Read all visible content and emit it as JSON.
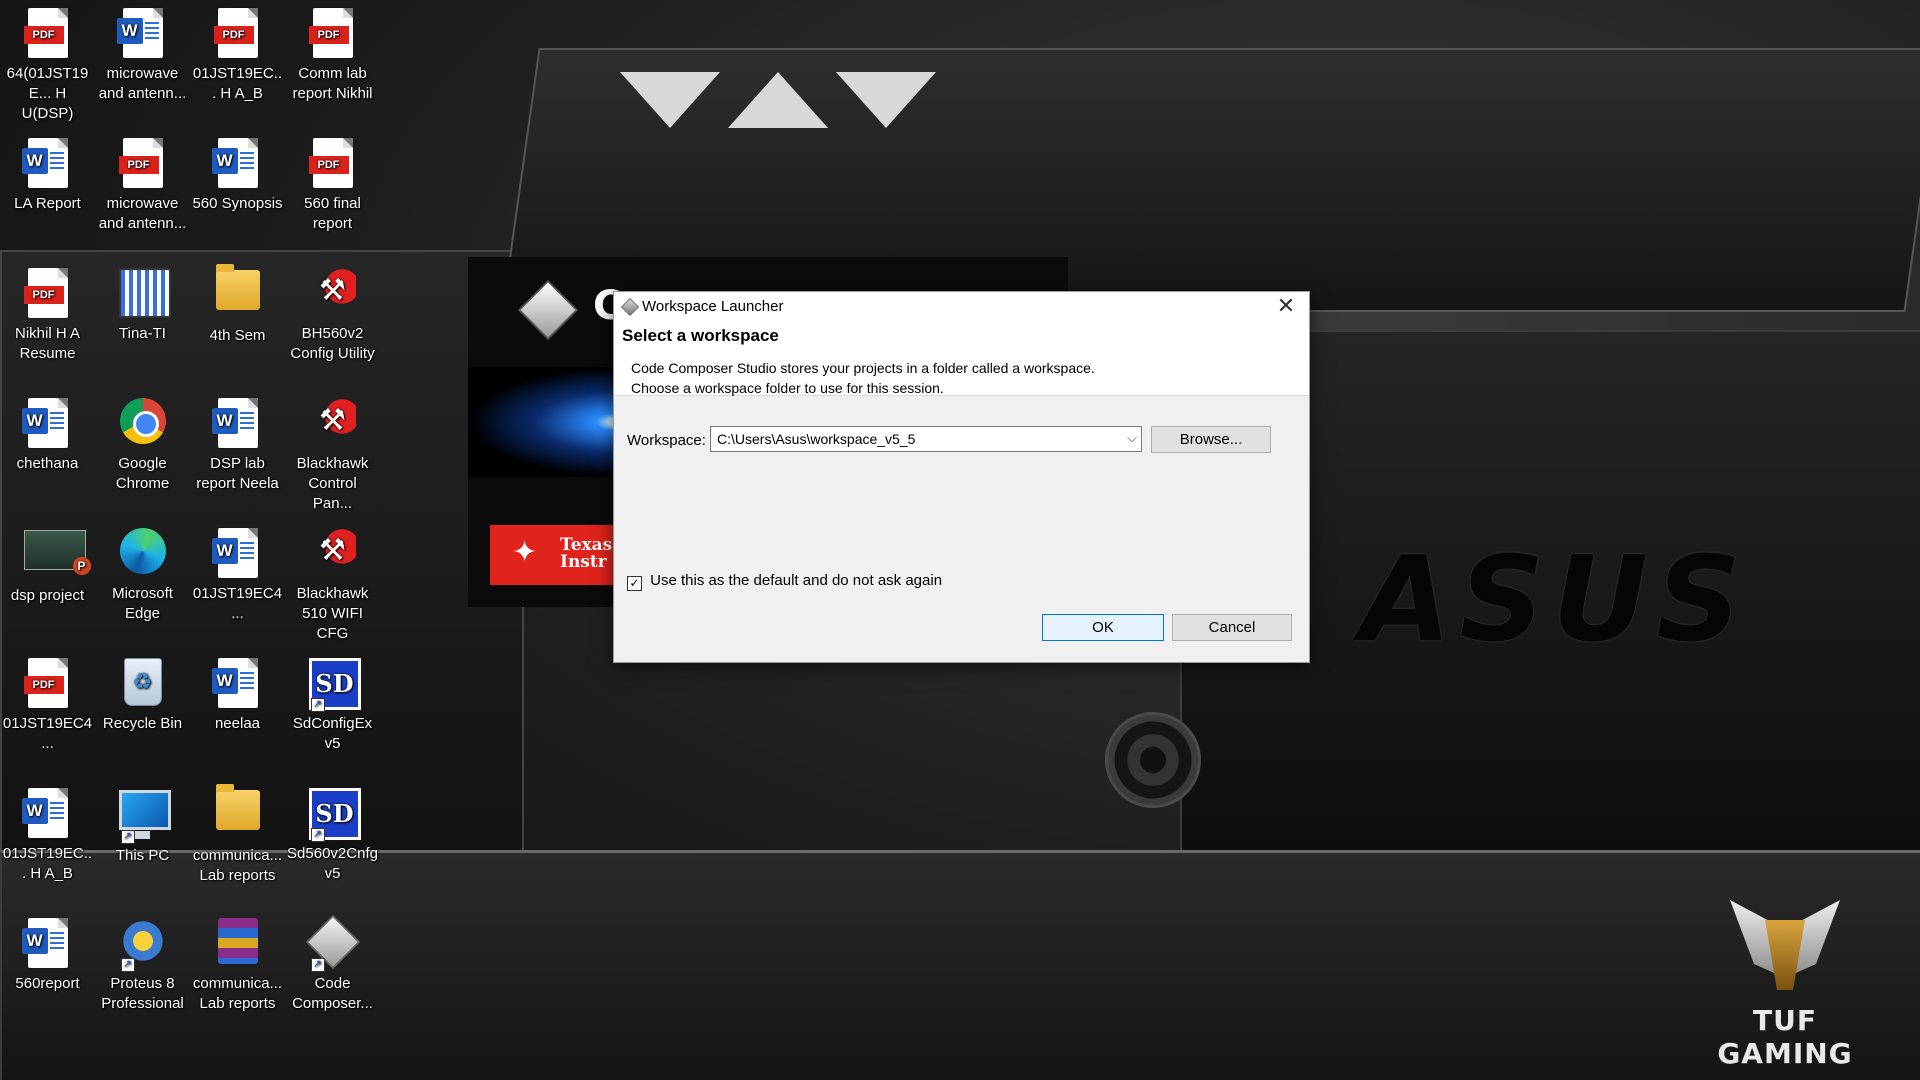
{
  "desktop": {
    "icons": [
      {
        "label": "64(01JST19E... H U(DSP)",
        "type": "pdf"
      },
      {
        "label": "microwave and antenn...",
        "type": "word"
      },
      {
        "label": "01JST19EC... H A_B",
        "type": "pdf"
      },
      {
        "label": "Comm lab report Nikhil",
        "type": "pdf"
      },
      {
        "label": "LA Report",
        "type": "word"
      },
      {
        "label": "microwave and antenn...",
        "type": "pdf"
      },
      {
        "label": "560 Synopsis",
        "type": "word"
      },
      {
        "label": "560 final report",
        "type": "pdf"
      },
      {
        "label": "Nikhil H A Resume",
        "type": "pdf"
      },
      {
        "label": "Tina-TI",
        "type": "tina"
      },
      {
        "label": "4th Sem",
        "type": "folder"
      },
      {
        "label": "BH560v2 Config Utility",
        "type": "tool"
      },
      {
        "label": "chethana",
        "type": "word"
      },
      {
        "label": "Google Chrome",
        "type": "chrome"
      },
      {
        "label": "DSP lab report Neela",
        "type": "word"
      },
      {
        "label": "Blackhawk Control Pan...",
        "type": "tool"
      },
      {
        "label": "dsp project",
        "type": "ppt"
      },
      {
        "label": "Microsoft Edge",
        "type": "edge"
      },
      {
        "label": "01JST19EC4...",
        "type": "word"
      },
      {
        "label": "Blackhawk 510 WIFI CFG",
        "type": "tool"
      },
      {
        "label": "01JST19EC4...",
        "type": "pdf"
      },
      {
        "label": "Recycle Bin",
        "type": "bin"
      },
      {
        "label": "neelaa",
        "type": "word"
      },
      {
        "label": "SdConfigEx v5",
        "type": "sd"
      },
      {
        "label": "01JST19EC... H A_B",
        "type": "word"
      },
      {
        "label": "This PC",
        "type": "pc"
      },
      {
        "label": "communica... Lab reports",
        "type": "folder"
      },
      {
        "label": "Sd560v2Cnfg v5",
        "type": "sd"
      },
      {
        "label": "560report",
        "type": "word"
      },
      {
        "label": "Proteus 8 Professional",
        "type": "proteus"
      },
      {
        "label": "communica... Lab reports",
        "type": "winrar"
      },
      {
        "label": "Code Composer...",
        "type": "cube"
      }
    ]
  },
  "wallpaper": {
    "brand_text": "ASUS",
    "tuf_text": "TUF GAMING"
  },
  "splash": {
    "title_letter": "C",
    "vendor": "Texas Instr"
  },
  "dialog": {
    "title": "Workspace Launcher",
    "close_glyph": "✕",
    "header_title": "Select a workspace",
    "header_line1": "Code Composer Studio stores your projects in a folder called a workspace.",
    "header_line2": "Choose a workspace folder to use for this session.",
    "workspace_label": "Workspace:",
    "workspace_value": "C:\\Users\\Asus\\workspace_v5_5",
    "browse_label": "Browse...",
    "default_checked": true,
    "default_label": "Use this as the default and do not ask again",
    "ok_label": "OK",
    "cancel_label": "Cancel"
  }
}
